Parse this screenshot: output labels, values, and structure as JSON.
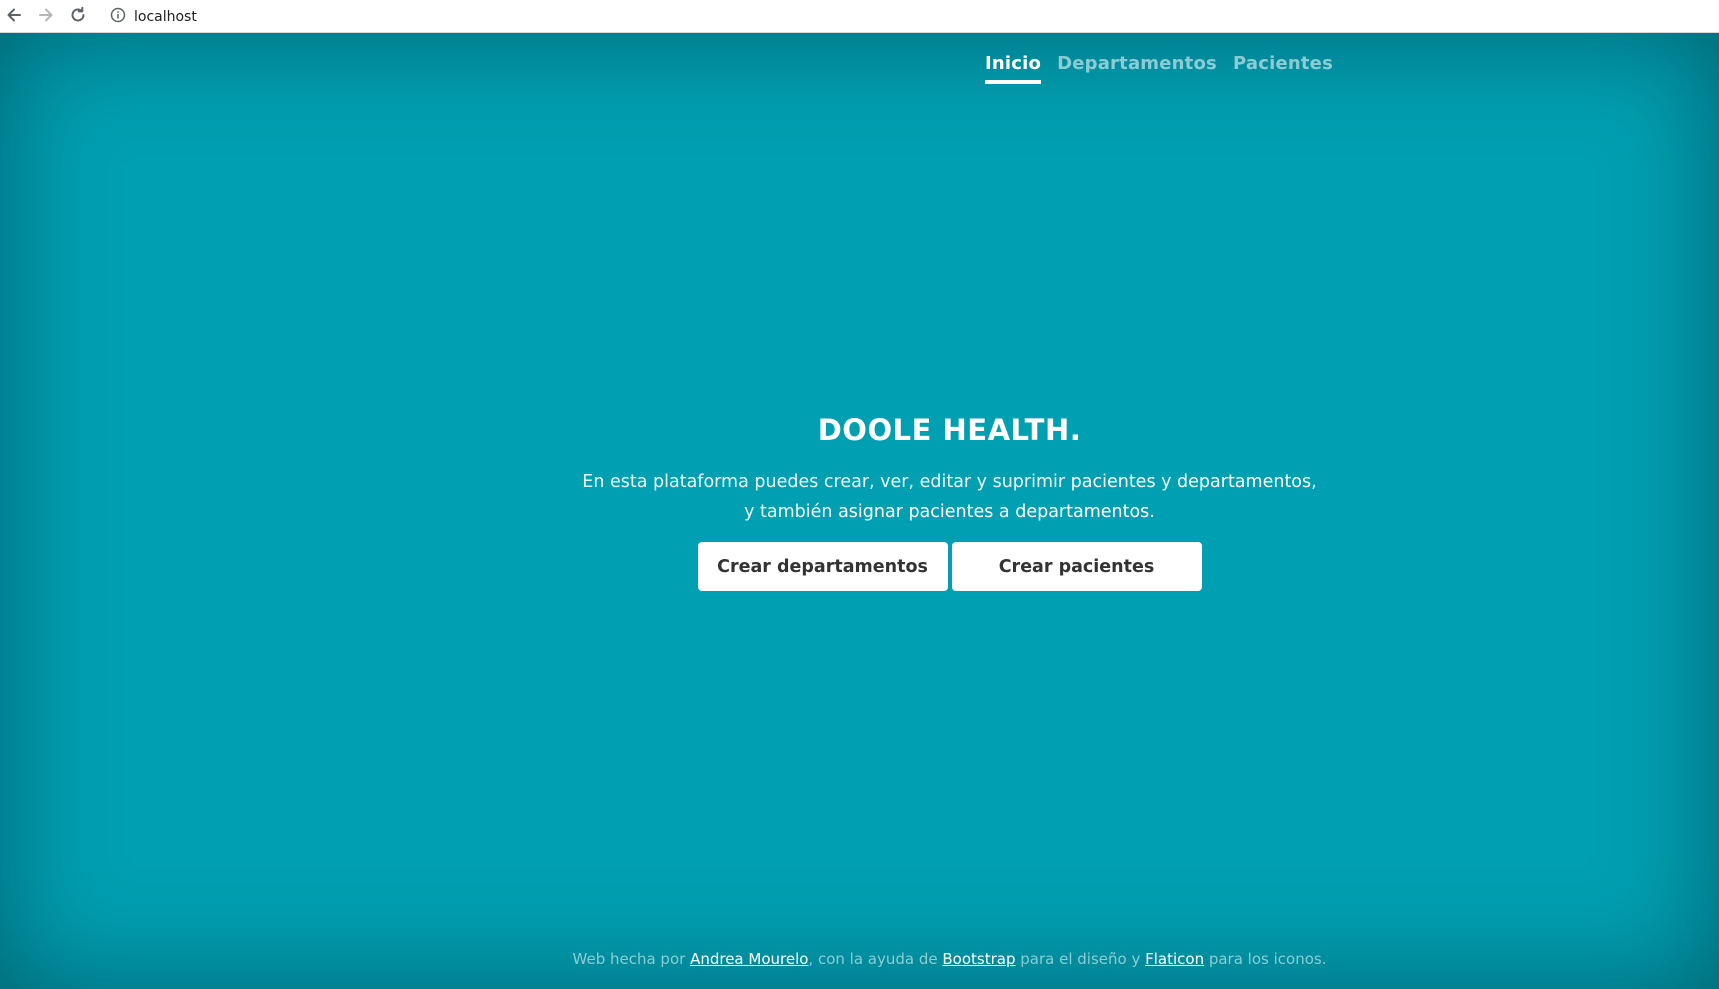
{
  "browser": {
    "url": "localhost",
    "back_icon": "arrow-left-icon",
    "forward_icon": "arrow-right-icon",
    "reload_icon": "reload-icon",
    "info_icon": "info-icon"
  },
  "nav": {
    "items": [
      {
        "label": "Inicio",
        "active": true
      },
      {
        "label": "Departamentos",
        "active": false
      },
      {
        "label": "Pacientes",
        "active": false
      }
    ]
  },
  "cover": {
    "title": "DOOLE HEALTH.",
    "lead": {
      "p1": "En esta plataforma puedes crear, ver, editar y suprimir ",
      "b1": "pacientes",
      "p2": " y ",
      "b2": "departamentos",
      "p3": ",",
      "p4": "y también ",
      "b3": "asignar pacientes a departamentos",
      "p5": "."
    },
    "buttons": {
      "create_departments": "Crear departamentos",
      "create_patients": "Crear pacientes"
    }
  },
  "footer": {
    "t1": "Web hecha por ",
    "l1": "Andrea Mourelo",
    "t2": ", con la ayuda de ",
    "l2": "Bootstrap",
    "t3": " para el diseño y ",
    "l3": "Flaticon",
    "t4": " para los iconos."
  },
  "colors": {
    "background": "#009fb2",
    "text": "#ffffff",
    "button_text": "#333333"
  }
}
